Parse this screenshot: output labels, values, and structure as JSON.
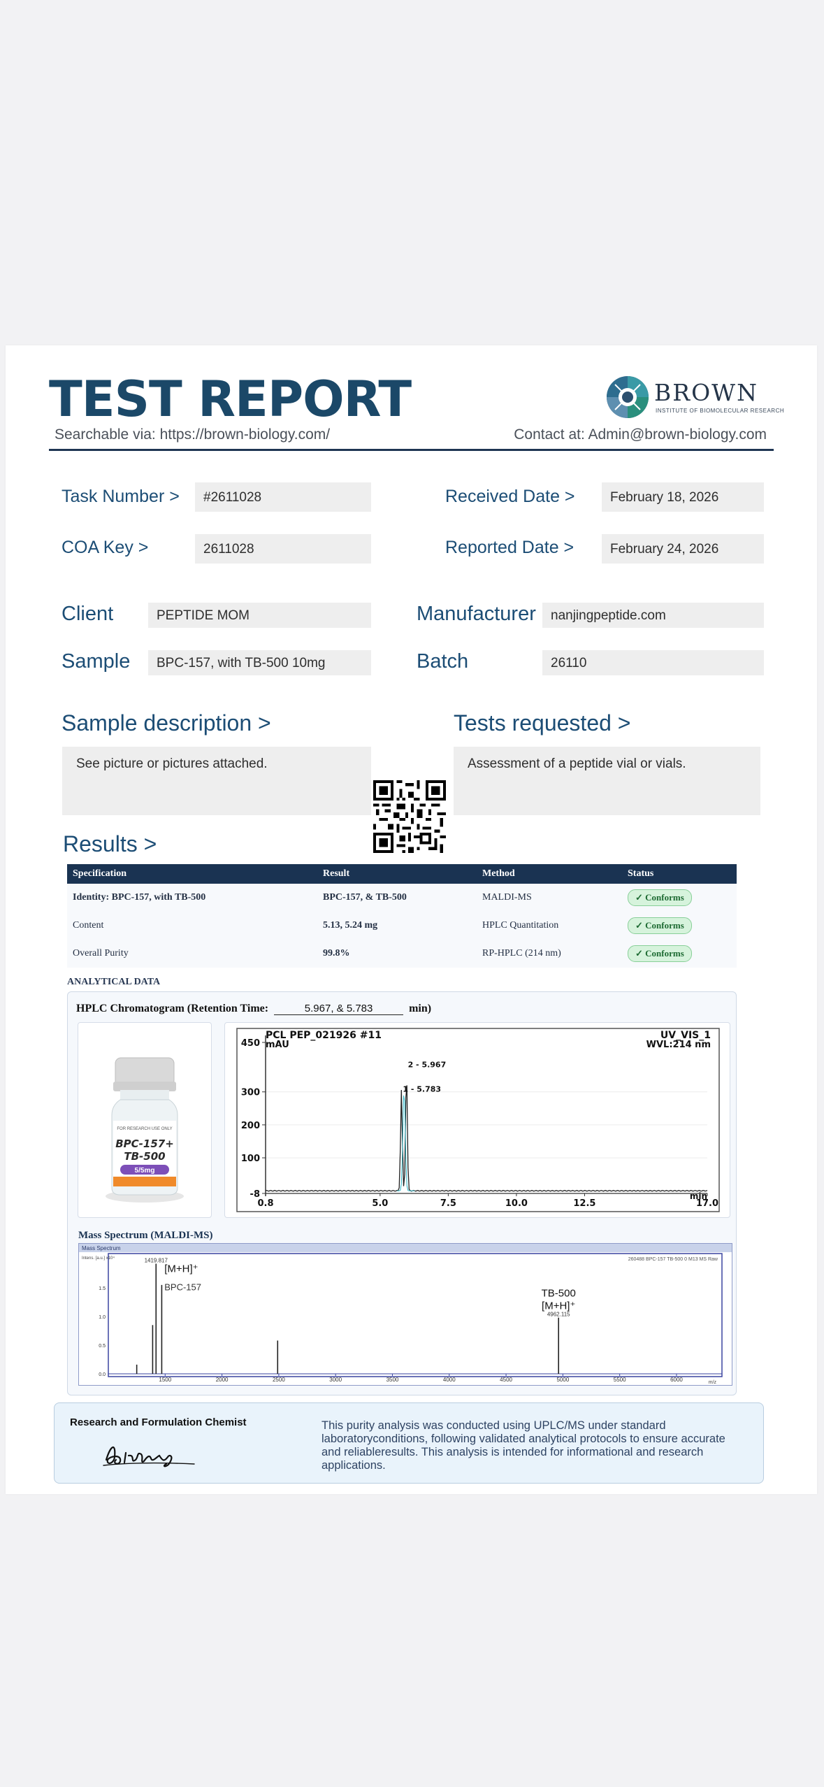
{
  "header": {
    "title": "TEST REPORT",
    "searchable": "Searchable via: https://brown-biology.com/",
    "contact": "Contact at: Admin@brown-biology.com",
    "logo_name": "BROWN",
    "logo_subtitle": "INSTITUTE OF BIOMOLECULAR RESEARCH"
  },
  "fields": {
    "task_number_label": "Task Number  >",
    "task_number": "#2611028",
    "coa_key_label": "COA  Key >",
    "coa_key": "2611028",
    "received_label": "Received Date  >",
    "received": "February 18, 2026",
    "reported_label": "Reported Date >",
    "reported": "February 24, 2026",
    "client_label": "Client",
    "client": "PEPTIDE MOM",
    "manufacturer_label": "Manufacturer",
    "manufacturer": "nanjingpeptide.com",
    "sample_label": "Sample",
    "sample": "BPC-157, with TB-500 10mg",
    "batch_label": "Batch",
    "batch": "26110"
  },
  "sample_description": {
    "title": "Sample description   >",
    "text": "See picture or pictures attached."
  },
  "tests_requested": {
    "title": "Tests requested   >",
    "text": "Assessment of a peptide vial or vials."
  },
  "results": {
    "title": "Results   >",
    "columns": [
      "Specification",
      "Result",
      "Method",
      "Status"
    ],
    "rows": [
      {
        "spec": "Identity:  BPC-157, with TB-500",
        "result": "BPC-157, & TB-500",
        "method": "MALDI-MS",
        "status": "✓ Conforms"
      },
      {
        "spec": "Content",
        "result": "5.13, 5.24   mg",
        "method": "HPLC Quantitation",
        "status": "✓ Conforms"
      },
      {
        "spec": "Overall Purity",
        "result": "99.8%",
        "method": "RP-HPLC (214 nm)",
        "status": "✓ Conforms"
      }
    ]
  },
  "analytical": {
    "label": "ANALYTICAL DATA",
    "hplc_caption_prefix": "HPLC Chromatogram (Retention Time:",
    "retention_times": "5.967, & 5.783",
    "hplc_caption_suffix": "min)",
    "vial_label_line1": "BPC-157+",
    "vial_label_line2": "TB-500",
    "vial_dose": "5/5mg",
    "vial_research": "FOR RESEARCH USE ONLY",
    "ms_caption": "Mass Spectrum (MALDI-MS)"
  },
  "chart_data": [
    {
      "type": "line",
      "title": "PCL PEP_021926 #11",
      "channel": "UV_VIS_1",
      "wavelength": "WVL:214 nm",
      "ylabel": "mAU",
      "xlabel": "min",
      "xlim": [
        0.8,
        17.0
      ],
      "ylim": [
        -8,
        450
      ],
      "x_ticks": [
        "0.8",
        "5.0",
        "7.5",
        "10.0",
        "12.5",
        "17.0"
      ],
      "y_ticks": [
        "450",
        "300",
        "200",
        "100",
        "-8"
      ],
      "peaks": [
        {
          "label": "2 - 5.967",
          "x": 5.967,
          "y": 370
        },
        {
          "label": "1 - 5.783",
          "x": 5.783,
          "y": 305
        }
      ]
    },
    {
      "type": "line",
      "title": "Mass Spectrum",
      "header_right": "260488 BPC-157 TB-500 0 M13 MS Raw",
      "ylabel": "Intens. [a.u.] x10⁴",
      "xlabel": "m/z",
      "xlim": [
        1000,
        6400
      ],
      "ylim": [
        0,
        2.0
      ],
      "x_ticks": [
        "1500",
        "2000",
        "2500",
        "3000",
        "3500",
        "4000",
        "4500",
        "5000",
        "5500",
        "6000"
      ],
      "y_ticks": [
        "1.5",
        "1.0",
        "0.5",
        "0.0"
      ],
      "peaks": [
        {
          "x": 1419.817,
          "y": 1.92,
          "label": "1419.817",
          "annotation": "[M+H]⁺",
          "name": "BPC-157"
        },
        {
          "x": 1470,
          "y": 1.55
        },
        {
          "x": 1390,
          "y": 0.85
        },
        {
          "x": 1250,
          "y": 0.16
        },
        {
          "x": 2490,
          "y": 0.58
        },
        {
          "x": 4962.115,
          "y": 0.98,
          "label": "4962.115",
          "annotation": "[M+H]⁺",
          "name": "TB-500"
        }
      ]
    }
  ],
  "footer": {
    "chemist_title": "Research and Formulation Chemist",
    "signature": "Bizbang",
    "disclaimer": "This purity analysis was conducted using UPLC/MS under standard laboratoryconditions, following validated analytical protocols to ensure accurate and reliableresults. This analysis is intended for informational and research applications."
  },
  "colors": {
    "navy": "#1a3352",
    "title_blue": "#1b4868",
    "label_blue": "#1c4d75",
    "field_bg": "#eeeeee",
    "conform_green": "#d6f3dc"
  }
}
